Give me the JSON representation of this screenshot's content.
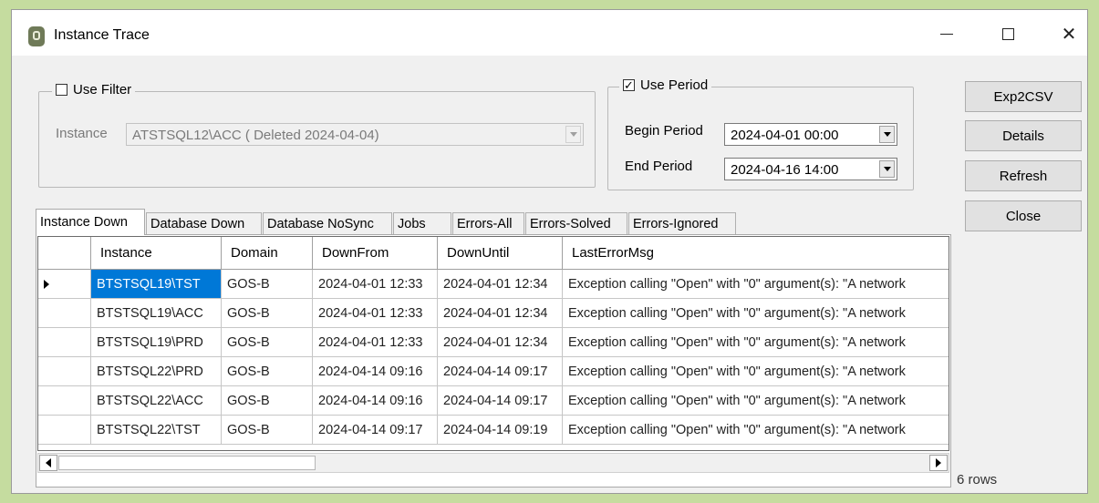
{
  "window": {
    "title": "Instance Trace",
    "controls": {
      "minimize": "–",
      "close": "✕"
    }
  },
  "filter": {
    "use_filter_label": "Use Filter",
    "use_filter_checked": false,
    "instance_label": "Instance",
    "instance_value": "ATSTSQL12\\ACC ( Deleted 2024-04-04)"
  },
  "period": {
    "use_period_label": "Use Period",
    "use_period_checked": true,
    "check_glyph": "✓",
    "begin_label": "Begin Period",
    "begin_value": "2024-04-01 00:00",
    "end_label": "End Period",
    "end_value": "2024-04-16 14:00"
  },
  "buttons": {
    "exp2csv": "Exp2CSV",
    "details": "Details",
    "refresh": "Refresh",
    "close": "Close"
  },
  "tabs": [
    {
      "label": "Instance Down",
      "active": true
    },
    {
      "label": "Database Down",
      "active": false
    },
    {
      "label": "Database NoSync",
      "active": false
    },
    {
      "label": "Jobs",
      "active": false
    },
    {
      "label": "Errors-All",
      "active": false
    },
    {
      "label": "Errors-Solved",
      "active": false
    },
    {
      "label": "Errors-Ignored",
      "active": false
    }
  ],
  "grid": {
    "columns": [
      "Instance",
      "Domain",
      "DownFrom",
      "DownUntil",
      "LastErrorMsg"
    ],
    "rows": [
      [
        "BTSTSQL19\\TST",
        "GOS-B",
        "2024-04-01 12:33",
        "2024-04-01 12:34",
        "Exception calling \"Open\" with \"0\" argument(s): \"A network"
      ],
      [
        "BTSTSQL19\\ACC",
        "GOS-B",
        "2024-04-01 12:33",
        "2024-04-01 12:34",
        "Exception calling \"Open\" with \"0\" argument(s): \"A network"
      ],
      [
        "BTSTSQL19\\PRD",
        "GOS-B",
        "2024-04-01 12:33",
        "2024-04-01 12:34",
        "Exception calling \"Open\" with \"0\" argument(s): \"A network"
      ],
      [
        "BTSTSQL22\\PRD",
        "GOS-B",
        "2024-04-14 09:16",
        "2024-04-14 09:17",
        "Exception calling \"Open\" with \"0\" argument(s): \"A network"
      ],
      [
        "BTSTSQL22\\ACC",
        "GOS-B",
        "2024-04-14 09:16",
        "2024-04-14 09:17",
        "Exception calling \"Open\" with \"0\" argument(s): \"A network"
      ],
      [
        "BTSTSQL22\\TST",
        "GOS-B",
        "2024-04-14 09:17",
        "2024-04-14 09:19",
        "Exception calling \"Open\" with \"0\" argument(s): \"A network"
      ]
    ],
    "selected_row": 0,
    "selected_color": "#0078d7"
  },
  "status": {
    "row_count": "6 rows"
  }
}
